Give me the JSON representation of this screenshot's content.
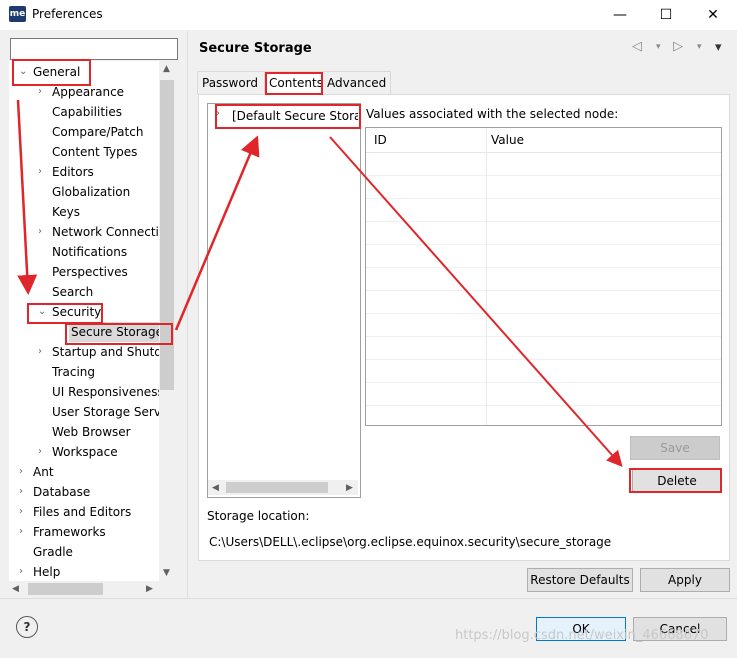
{
  "window": {
    "title": "Preferences",
    "app_icon": "me",
    "minimize": "—",
    "maximize": "☐",
    "close": "✕"
  },
  "search": {
    "value": "",
    "placeholder": ""
  },
  "tree": [
    {
      "label": "General",
      "level": 0,
      "expander": "open"
    },
    {
      "label": "Appearance",
      "level": 1,
      "expander": "closed"
    },
    {
      "label": "Capabilities",
      "level": 1,
      "expander": "none"
    },
    {
      "label": "Compare/Patch",
      "level": 1,
      "expander": "none"
    },
    {
      "label": "Content Types",
      "level": 1,
      "expander": "none"
    },
    {
      "label": "Editors",
      "level": 1,
      "expander": "closed"
    },
    {
      "label": "Globalization",
      "level": 1,
      "expander": "none"
    },
    {
      "label": "Keys",
      "level": 1,
      "expander": "none"
    },
    {
      "label": "Network Connecti",
      "level": 1,
      "expander": "closed"
    },
    {
      "label": "Notifications",
      "level": 1,
      "expander": "none"
    },
    {
      "label": "Perspectives",
      "level": 1,
      "expander": "none"
    },
    {
      "label": "Search",
      "level": 1,
      "expander": "none"
    },
    {
      "label": "Security",
      "level": 1,
      "expander": "open"
    },
    {
      "label": "Secure Storage",
      "level": 2,
      "expander": "none",
      "selected": true
    },
    {
      "label": "Startup and Shutd",
      "level": 1,
      "expander": "closed"
    },
    {
      "label": "Tracing",
      "level": 1,
      "expander": "none"
    },
    {
      "label": "UI Responsiveness",
      "level": 1,
      "expander": "none"
    },
    {
      "label": "User Storage Serv",
      "level": 1,
      "expander": "none"
    },
    {
      "label": "Web Browser",
      "level": 1,
      "expander": "none"
    },
    {
      "label": "Workspace",
      "level": 1,
      "expander": "closed"
    },
    {
      "label": "Ant",
      "level": 0,
      "expander": "closed"
    },
    {
      "label": "Database",
      "level": 0,
      "expander": "closed"
    },
    {
      "label": "Files and Editors",
      "level": 0,
      "expander": "closed"
    },
    {
      "label": "Frameworks",
      "level": 0,
      "expander": "closed"
    },
    {
      "label": "Gradle",
      "level": 0,
      "expander": "none"
    },
    {
      "label": "Help",
      "level": 0,
      "expander": "closed"
    }
  ],
  "page": {
    "title": "Secure Storage",
    "tabs": [
      {
        "label": "Password"
      },
      {
        "label": "Contents",
        "active": true
      },
      {
        "label": "Advanced"
      }
    ],
    "node": "[Default Secure Storag",
    "values_label": "Values associated with the selected node:",
    "columns": {
      "id": "ID",
      "value": "Value"
    },
    "save": "Save",
    "delete": "Delete",
    "storage_location_label": "Storage location:",
    "storage_location": "C:\\Users\\DELL\\.eclipse\\org.eclipse.equinox.security\\secure_storage",
    "restore_defaults": "Restore Defaults",
    "apply": "Apply"
  },
  "footer": {
    "help": "?",
    "ok": "OK",
    "cancel": "Cancel",
    "watermark": "https://blog.csdn.net/weixin_46668670"
  },
  "colors": {
    "annotation": "#e0262a",
    "accent": "#0078d7",
    "brand": "#1d3b70"
  },
  "icons": {
    "back": "◁",
    "forward": "▷",
    "dropdown": "▾",
    "expand": "›",
    "collapse": "⌄"
  }
}
